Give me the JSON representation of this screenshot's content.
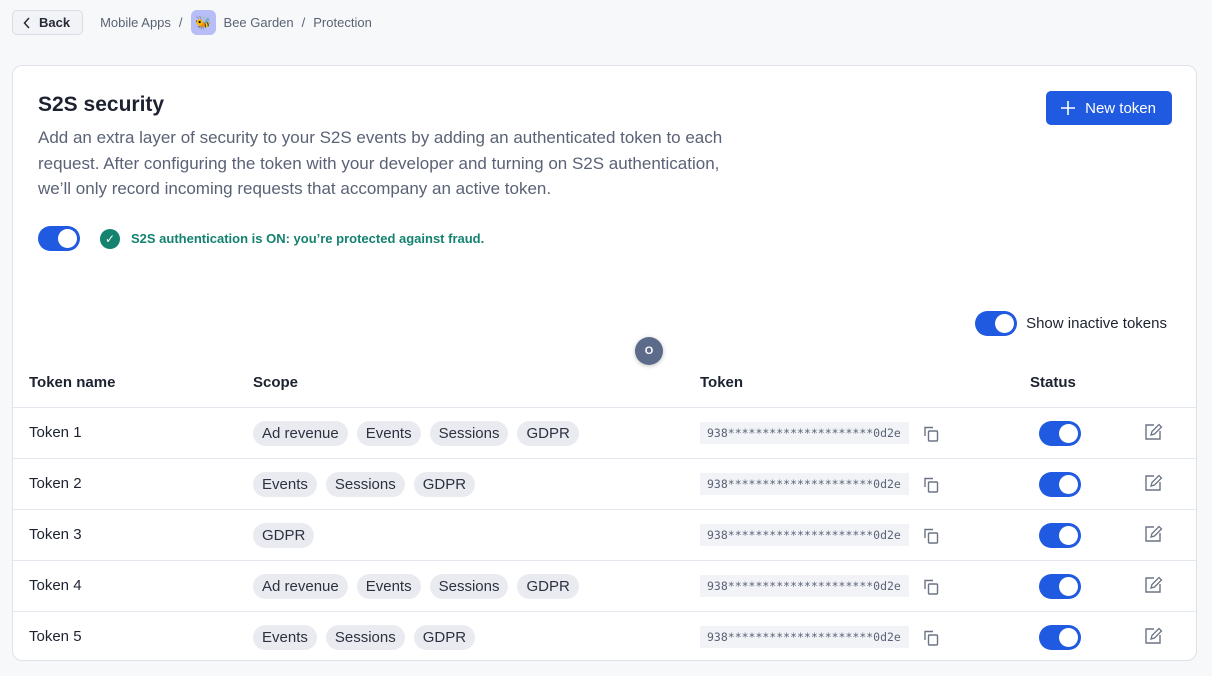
{
  "nav": {
    "back": "Back",
    "breadcrumbs": [
      "Mobile Apps",
      "Bee Garden",
      "Protection"
    ],
    "app_icon": "🐝",
    "separator": "/"
  },
  "header": {
    "title": "S2S security",
    "description": "Add an extra layer of security to your S2S events by adding an authenticated token to each request. After configuring the token with your developer and turning on S2S authentication, we’ll only record incoming requests that accompany an active token.",
    "new_token": "New token"
  },
  "auth": {
    "enabled": true,
    "status": "S2S authentication is ON: you’re protected against fraud."
  },
  "show_inactive": {
    "label": "Show inactive tokens",
    "enabled": true
  },
  "bubble": "O",
  "table": {
    "columns": [
      "Token name",
      "Scope",
      "Token",
      "Status"
    ],
    "rows": [
      {
        "name": "Token 1",
        "scope": [
          "Ad revenue",
          "Events",
          "Sessions",
          "GDPR"
        ],
        "token": "938*********************0d2e",
        "active": true
      },
      {
        "name": "Token 2",
        "scope": [
          "Events",
          "Sessions",
          "GDPR"
        ],
        "token": "938*********************0d2e",
        "active": true
      },
      {
        "name": "Token 3",
        "scope": [
          "GDPR"
        ],
        "token": "938*********************0d2e",
        "active": true
      },
      {
        "name": "Token 4",
        "scope": [
          "Ad revenue",
          "Events",
          "Sessions",
          "GDPR"
        ],
        "token": "938*********************0d2e",
        "active": true
      },
      {
        "name": "Token 5",
        "scope": [
          "Events",
          "Sessions",
          "GDPR"
        ],
        "token": "938*********************0d2e",
        "active": true
      }
    ]
  },
  "colors": {
    "accent": "#1f5ae0",
    "success": "#13826f"
  }
}
